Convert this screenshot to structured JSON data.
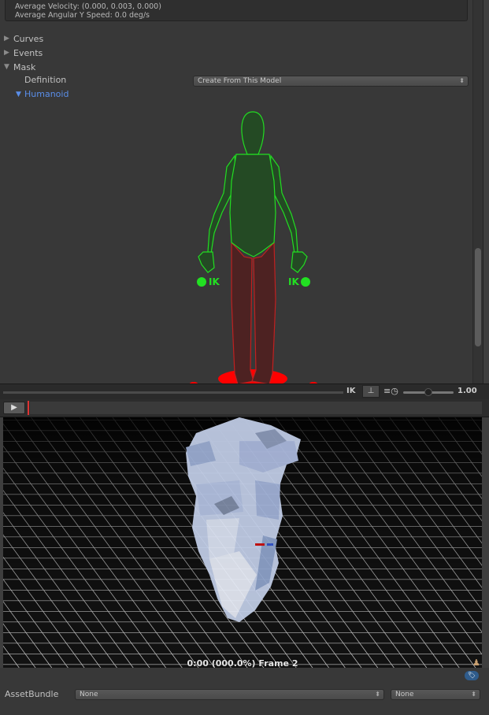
{
  "inspector": {
    "info_lines": [
      "Average Velocity: (0.000, 0.003, 0.000)",
      "Average Angular Y Speed: 0.0 deg/s"
    ],
    "foldouts": [
      {
        "label": "Curves",
        "expanded": false
      },
      {
        "label": "Events",
        "expanded": false
      },
      {
        "label": "Mask",
        "expanded": true
      }
    ],
    "mask": {
      "definition_label": "Definition",
      "definition_value": "Create From This Model",
      "humanoid_label": "Humanoid"
    },
    "figure": {
      "left_ik_label": "IK",
      "right_ik_label": "IK",
      "colors": {
        "enabled": "#00ff00",
        "disabled": "#ff0000"
      }
    }
  },
  "timeline": {
    "ik_label": "IK",
    "pivot_icon": "pivot-icon",
    "speed_icon": "speed-icon",
    "speed_value": "1.00",
    "speed_level": 0.5
  },
  "preview": {
    "play_icon": "play-icon",
    "time_label": "0:00 (000.0%) Frame 2",
    "avatar_icon": "avatar-icon"
  },
  "bottom": {
    "tag_icon": "tag-icon",
    "assetbundle_label": "AssetBundle",
    "assetbundle_name": "None",
    "assetbundle_variant": "None"
  }
}
